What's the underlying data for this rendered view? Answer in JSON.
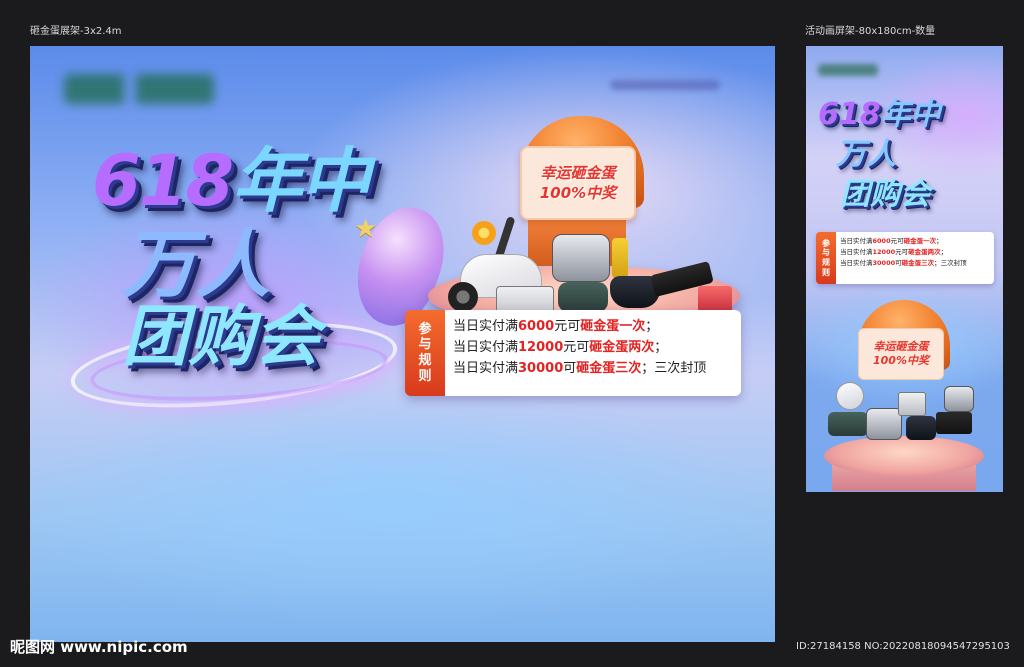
{
  "captions": {
    "left": "砸金蛋展架-3x2.4m",
    "right": "活动画屏架-80x180cm-数量"
  },
  "banner": {
    "title_num": "618",
    "title_line1": "年中",
    "title_line2": "万人",
    "title_line3": "团购会",
    "egg_line1": "幸运砸金蛋",
    "egg_line2": "100%中奖",
    "rules_tag": "参与规则",
    "rules": [
      {
        "prefix": "当日实付满",
        "amount": "6000",
        "mid": "元可",
        "result": "砸金蛋一次",
        "suffix": "；"
      },
      {
        "prefix": "当日实付满",
        "amount": "12000",
        "mid": "元可",
        "result": "砸金蛋两次",
        "suffix": "；"
      },
      {
        "prefix": "当日实付满",
        "amount": "30000",
        "mid": "可",
        "result": "砸金蛋三次",
        "suffix": "；三次封顶"
      }
    ]
  },
  "poster": {
    "title_num": "618",
    "title_line1": "年中",
    "title_line2": "万人",
    "title_line3": "团购会",
    "egg_line1": "幸运砸金蛋",
    "egg_line2": "100%中奖",
    "rules_tag": "参与规则"
  },
  "footer": {
    "logo": "昵图网 www.nipic.com",
    "id_text": "ID:27184158 NO:20220818094547295103"
  },
  "colors": {
    "accent_red": "#e52222",
    "accent_orange": "#f07a27",
    "title_blue": "#7bd7ff",
    "title_purple": "#b66cff"
  }
}
